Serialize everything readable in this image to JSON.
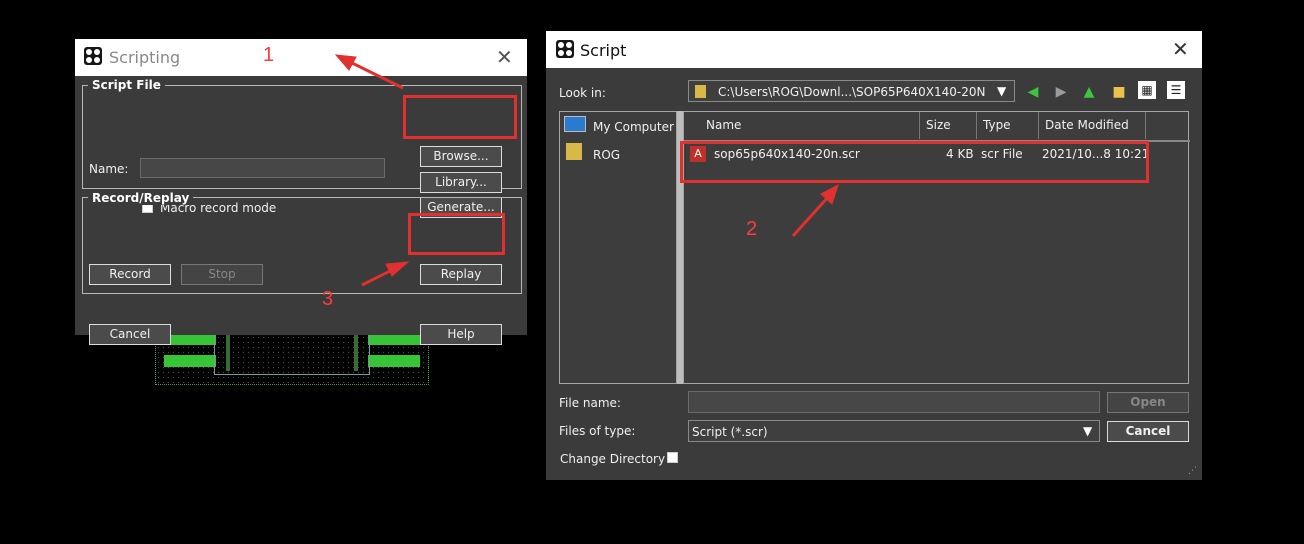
{
  "scripting": {
    "title": "Scripting",
    "script_file_group": "Script File",
    "name_label": "Name:",
    "name_value": "",
    "macro_label": "Macro record mode",
    "browse_label": "Browse...",
    "library_label": "Library...",
    "generate_label": "Generate...",
    "record_replay_group": "Record/Replay",
    "record_label": "Record",
    "stop_label": "Stop",
    "replay_label": "Replay",
    "cancel_label": "Cancel",
    "help_label": "Help"
  },
  "script_dialog": {
    "title": "Script",
    "look_in_label": "Look in:",
    "look_in_value": "C:\\Users\\ROG\\Downl...\\SOP65P640X140-20N",
    "places": [
      {
        "label": "My Computer",
        "icon": "computer-icon"
      },
      {
        "label": "ROG",
        "icon": "user-folder-icon"
      }
    ],
    "columns": [
      "Name",
      "Size",
      "Type",
      "Date Modified"
    ],
    "files": [
      {
        "name": "sop65p640x140-20n.scr",
        "size": "4 KB",
        "type": "scr File",
        "date": "2021/10...8 10:21"
      }
    ],
    "file_name_label": "File name:",
    "file_name_value": "",
    "files_of_type_label": "Files of type:",
    "files_of_type_value": "Script (*.scr)",
    "change_dir_label": "Change Directory",
    "open_label": "Open",
    "cancel_label": "Cancel"
  },
  "annotations": [
    "1",
    "2",
    "3"
  ],
  "colors": {
    "annotation": "#e03030",
    "dialog_bg": "#3b3b3b",
    "pcb_pad": "#37c437"
  }
}
